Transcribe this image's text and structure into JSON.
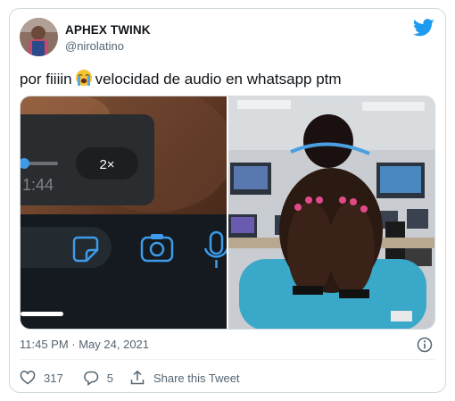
{
  "user": {
    "name": "APHEX TWINK",
    "handle": "@nirolatino"
  },
  "tweet": {
    "text_before": "por fiiiin",
    "text_after": "velocidad de audio en whatsapp ptm",
    "emoji": "loudly-crying-face"
  },
  "media_left": {
    "speed_label": "2×",
    "time_label": "1:44",
    "icons": [
      "sticker-icon",
      "camera-icon",
      "microphone-icon"
    ]
  },
  "meta": {
    "timestamp": "11:45 PM · May 24, 2021"
  },
  "actions": {
    "likes": "317",
    "replies": "5",
    "share_label": "Share this Tweet"
  },
  "colors": {
    "twitter_blue": "#1d9bf0",
    "text_primary": "#0f1419",
    "text_secondary": "#536471",
    "border": "#cfd9de",
    "whatsapp_icon_blue": "#3d9be9"
  },
  "icons": [
    "twitter-bird-icon",
    "info-icon",
    "heart-icon",
    "reply-icon",
    "share-icon"
  ]
}
